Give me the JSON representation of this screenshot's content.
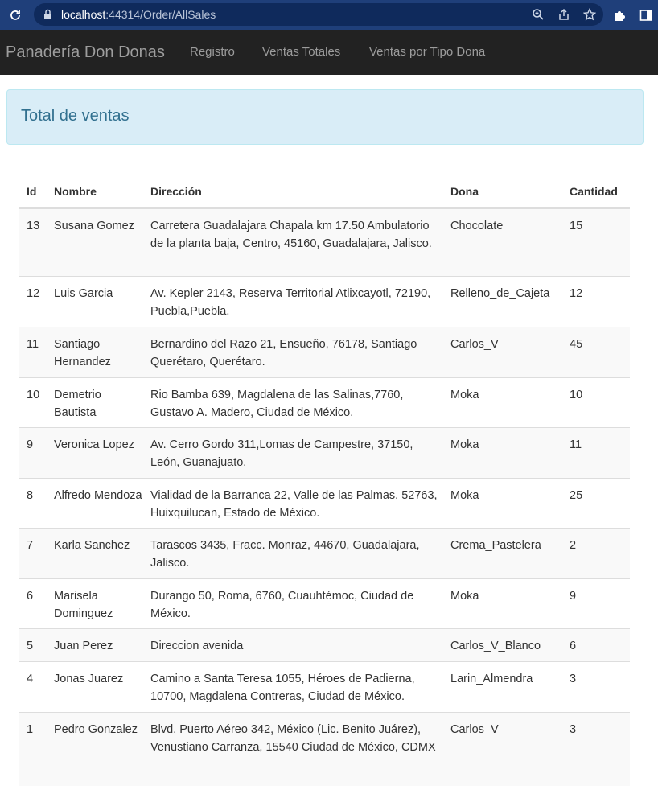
{
  "browser": {
    "url_host": "localhost",
    "url_path": ":44314/Order/AllSales"
  },
  "navbar": {
    "brand": "Panadería Don Donas",
    "links": [
      "Registro",
      "Ventas Totales",
      "Ventas por Tipo Dona"
    ]
  },
  "alert": {
    "title": "Total de ventas"
  },
  "table": {
    "headers": [
      "Id",
      "Nombre",
      "Dirección",
      "Dona",
      "Cantidad"
    ],
    "rows": [
      {
        "id": "13",
        "nombre": "Susana Gomez",
        "direccion": "Carretera Guadalajara Chapala km 17.50 Ambulatorio de la planta baja, Centro, 45160, Guadalajara, Jalisco.",
        "dona": "Chocolate",
        "cantidad": "15"
      },
      {
        "id": "12",
        "nombre": "Luis Garcia",
        "direccion": "Av. Kepler 2143, Reserva Territorial Atlixcayotl, 72190, Puebla,Puebla.",
        "dona": "Relleno_de_Cajeta",
        "cantidad": "12"
      },
      {
        "id": "11",
        "nombre": "Santiago Hernandez",
        "direccion": "Bernardino del Razo 21, Ensueño, 76178, Santiago Querétaro, Querétaro.",
        "dona": "Carlos_V",
        "cantidad": "45"
      },
      {
        "id": "10",
        "nombre": "Demetrio Bautista",
        "direccion": "Rio Bamba 639, Magdalena de las Salinas,7760, Gustavo A. Madero, Ciudad de México.",
        "dona": "Moka",
        "cantidad": "10"
      },
      {
        "id": "9",
        "nombre": "Veronica Lopez",
        "direccion": "Av. Cerro Gordo 311,Lomas de Campestre, 37150, León, Guanajuato.",
        "dona": "Moka",
        "cantidad": "11"
      },
      {
        "id": "8",
        "nombre": "Alfredo Mendoza",
        "direccion": "Vialidad de la Barranca 22, Valle de las Palmas, 52763, Huixquilucan, Estado de México.",
        "dona": "Moka",
        "cantidad": "25"
      },
      {
        "id": "7",
        "nombre": "Karla Sanchez",
        "direccion": "Tarascos 3435, Fracc. Monraz, 44670, Guadalajara, Jalisco.",
        "dona": "Crema_Pastelera",
        "cantidad": "2"
      },
      {
        "id": "6",
        "nombre": "Marisela Dominguez",
        "direccion": "Durango 50, Roma, 6760, Cuauhtémoc, Ciudad de México.",
        "dona": "Moka",
        "cantidad": "9"
      },
      {
        "id": "5",
        "nombre": "Juan Perez",
        "direccion": "Direccion avenida",
        "dona": "Carlos_V_Blanco",
        "cantidad": "6"
      },
      {
        "id": "4",
        "nombre": "Jonas Juarez",
        "direccion": "Camino a Santa Teresa 1055, Héroes de Padierna, 10700, Magdalena Contreras, Ciudad de México.",
        "dona": "Larin_Almendra",
        "cantidad": "3"
      },
      {
        "id": "1",
        "nombre": "Pedro Gonzalez",
        "direccion": "Blvd. Puerto Aéreo 342, México (Lic. Benito Juárez), Venustiano Carranza, 15540 Ciudad de México, CDMX",
        "dona": "Carlos_V",
        "cantidad": "3"
      }
    ]
  },
  "colors": {
    "chrome": "#1f3f7a",
    "navbar": "#222222",
    "alert_bg": "#d9edf7",
    "alert_text": "#31708f"
  }
}
